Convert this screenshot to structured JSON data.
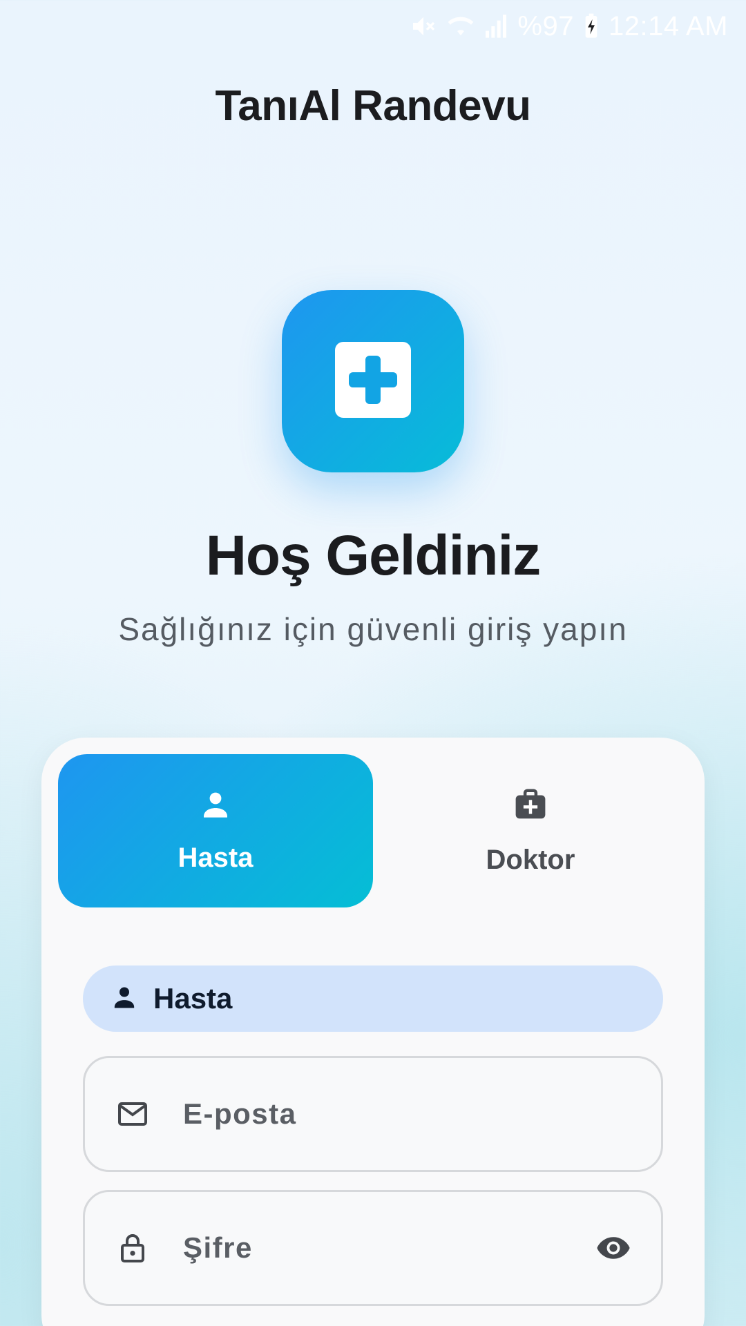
{
  "status_bar": {
    "battery_text": "%97",
    "time": "12:14 AM",
    "icons": [
      "mute-icon",
      "wifi-icon",
      "signal-icon",
      "battery-charging-icon"
    ]
  },
  "app": {
    "title": "TanıAl Randevu"
  },
  "logo": {
    "icon": "medical-cross-icon"
  },
  "hero": {
    "title": "Hoş Geldiniz",
    "subtitle": "Sağlığınız için güvenli giriş yapın"
  },
  "role_tabs": [
    {
      "label": "Hasta",
      "icon": "person-icon",
      "selected": true
    },
    {
      "label": "Doktor",
      "icon": "medical-bag-icon",
      "selected": false
    }
  ],
  "selected_role_chip": {
    "label": "Hasta",
    "icon": "person-icon"
  },
  "form": {
    "email": {
      "placeholder": "E-posta",
      "value": "",
      "icon": "mail-icon"
    },
    "password": {
      "placeholder": "Şifre",
      "value": "",
      "icon": "lock-icon",
      "toggle_icon": "eye-icon"
    }
  },
  "colors": {
    "accent_start": "#1e96f0",
    "accent_end": "#05bed5",
    "chip_bg": "#d2e3fb",
    "text_dark": "#1b1c1f"
  }
}
